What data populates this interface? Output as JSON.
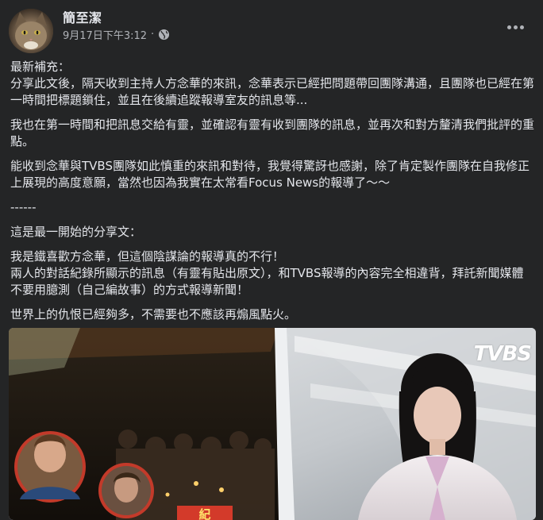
{
  "author": {
    "name": "簡至潔",
    "timestamp": "9月17日下午3:12",
    "separator": "·",
    "privacy_icon": "globe-icon"
  },
  "post": {
    "paragraphs": [
      "最新補充：\n分享此文後，隔天收到主持人方念華的來訊，念華表示已經把問題帶回團隊溝通，且團隊也已經在第一時間把標題鎖住，並且在後續追蹤報導室友的訊息等...",
      "我也在第一時間和把訊息交給有靈，並確認有靈有收到團隊的訊息，並再次和對方釐清我們批評的重點。",
      "能收到念華與TVBS團隊如此慎重的來訊和對待，我覺得驚訝也感謝，除了肯定製作團隊在自我修正上展現的高度意願，當然也因為我實在太常看Focus News的報導了～～",
      "------",
      "這是最一開始的分享文：",
      "我是鐵喜歡方念華，但這個陰謀論的報導真的不行！\n兩人的對話紀錄所顯示的訊息（有靈有貼出原文），和TVBS報導的內容完全相違背，拜託新聞媒體不要用臆測（自己編故事）的方式報導新聞！",
      "世界上的仇恨已經夠多，不需要也不應該再煽風點火。"
    ]
  },
  "media": {
    "logo_text": "TVBS",
    "caption_fragment": "紀"
  },
  "icons": {
    "more": "more-options-icon",
    "avatar": "avatar"
  },
  "colors": {
    "background": "#242526",
    "text_primary": "#e4e6eb",
    "text_secondary": "#b0b3b8"
  }
}
